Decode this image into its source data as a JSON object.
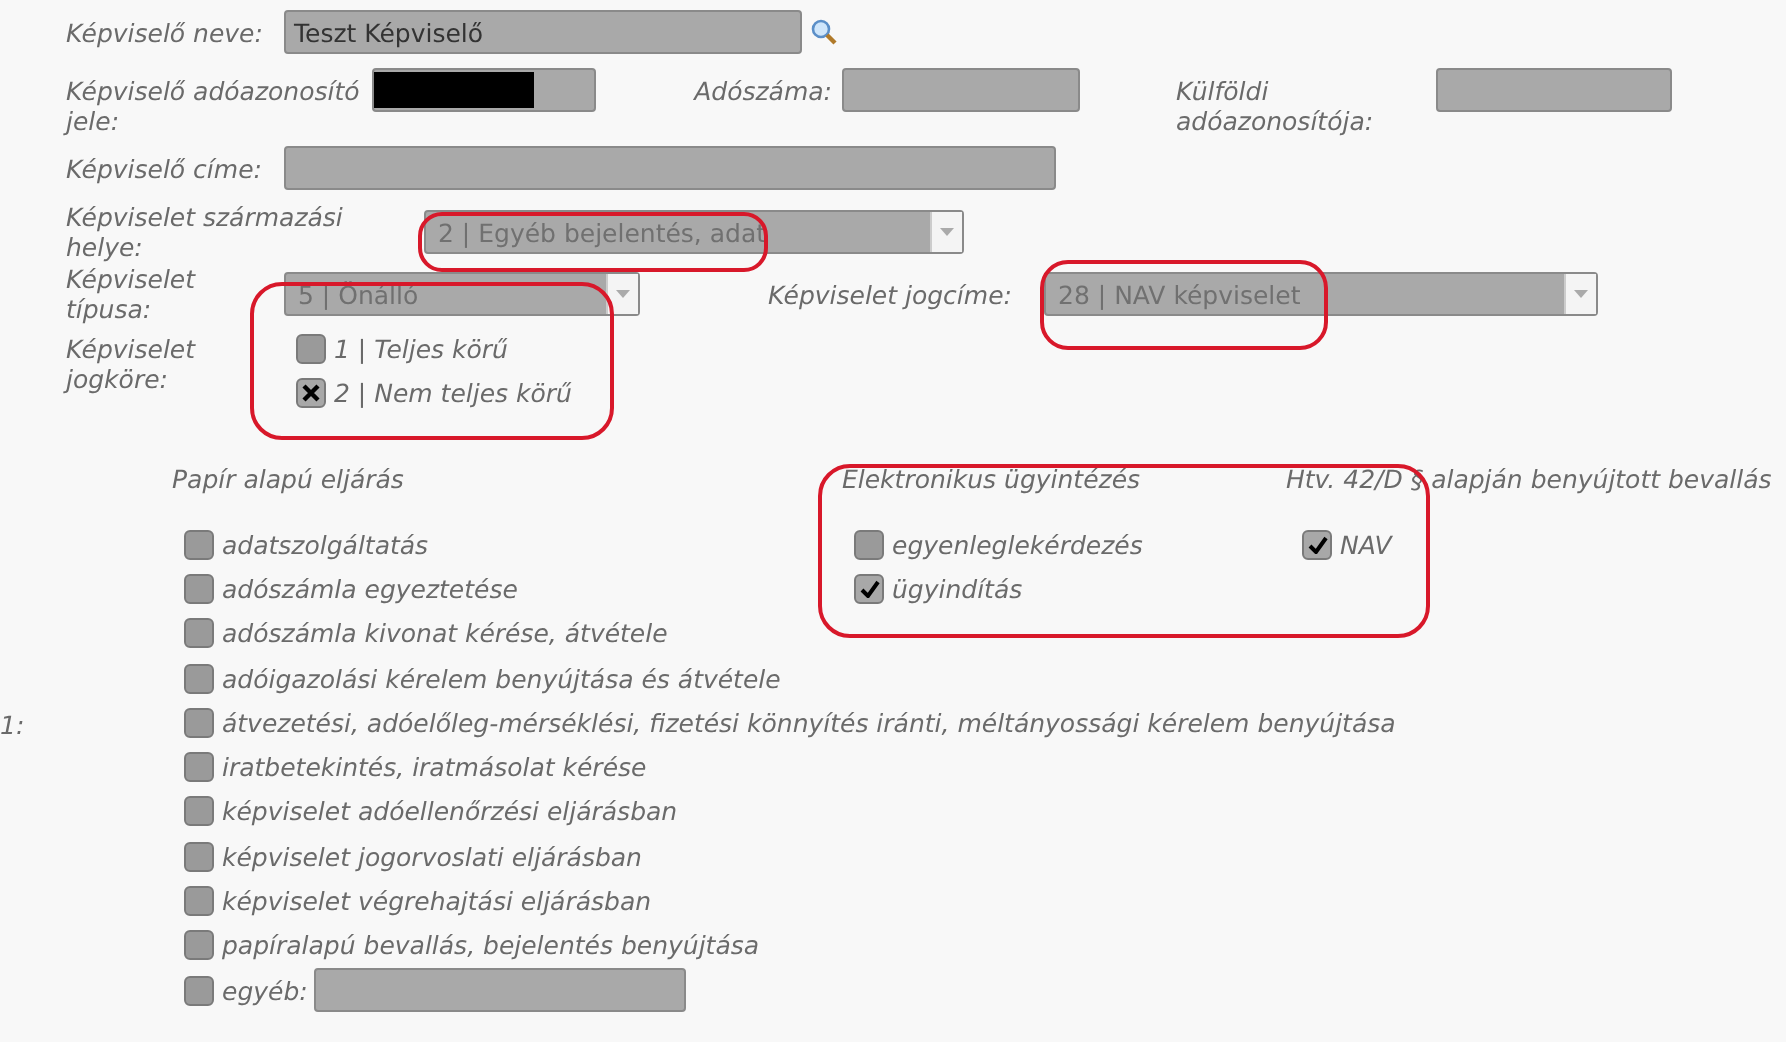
{
  "representative": {
    "name_label": "Képviselő neve:",
    "name_value": "Teszt Képviselő",
    "tax_id_label": "Képviselő adóazonosító jele:",
    "tax_number_label": "Adószáma:",
    "foreign_tax_id_label": "Külföldi adóazonosítója:",
    "address_label": "Képviselő címe:"
  },
  "origin": {
    "label": "Képviselet származási helye:",
    "value": "2 | Egyéb bejelentés, adat"
  },
  "type": {
    "label": "Képviselet típusa:",
    "value": "5 | Önálló"
  },
  "legal_title": {
    "label": "Képviselet jogcíme:",
    "value": "28 | NAV képviselet"
  },
  "scope": {
    "label": "Képviselet jogköre:",
    "options": [
      {
        "label": "1 | Teljes körű",
        "checked": false
      },
      {
        "label": "2 | Nem teljes körű",
        "checked": true
      }
    ]
  },
  "row_label": "1:",
  "paper": {
    "title": "Papír alapú eljárás",
    "items": [
      {
        "label": "adatszolgáltatás",
        "checked": false
      },
      {
        "label": "adószámla egyeztetése",
        "checked": false
      },
      {
        "label": "adószámla kivonat kérése, átvétele",
        "checked": false
      },
      {
        "label": "adóigazolási kérelem benyújtása és átvétele",
        "checked": false
      },
      {
        "label": "átvezetési, adóelőleg-mérséklési, fizetési könnyítés iránti, méltányossági kérelem benyújtása",
        "checked": false
      },
      {
        "label": "iratbetekintés, iratmásolat kérése",
        "checked": false
      },
      {
        "label": "képviselet adóellenőrzési eljárásban",
        "checked": false
      },
      {
        "label": "képviselet jogorvoslati eljárásban",
        "checked": false
      },
      {
        "label": "képviselet végrehajtási eljárásban",
        "checked": false
      },
      {
        "label": "papíralapú bevallás, bejelentés benyújtása",
        "checked": false
      },
      {
        "label": "egyéb:",
        "checked": false,
        "kind": "other"
      }
    ]
  },
  "electronic": {
    "title": "Elektronikus ügyintézés",
    "items": [
      {
        "label": "egyenleglekérdezés",
        "checked": false
      },
      {
        "label": "ügyindítás",
        "checked": true
      }
    ]
  },
  "htv": {
    "title": "Htv. 42/D § alapján benyújtott bevallás",
    "items": [
      {
        "label": "NAV",
        "checked": true
      }
    ]
  }
}
